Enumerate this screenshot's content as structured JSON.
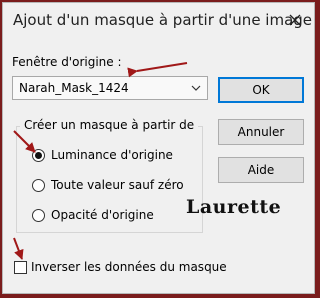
{
  "window": {
    "title": "Ajout d'un masque à partir d'une image",
    "close_icon": "close-icon"
  },
  "origin": {
    "label": "Fenêtre d'origine :",
    "selected_value": "Narah_Mask_1424",
    "dropdown_icon": "chevron-down-icon"
  },
  "buttons": {
    "ok": "OK",
    "cancel": "Annuler",
    "help": "Aide"
  },
  "group": {
    "legend": "Créer un masque à partir de",
    "options": [
      {
        "label": "Luminance d'origine",
        "selected": true
      },
      {
        "label": "Toute valeur sauf zéro",
        "selected": false
      },
      {
        "label": "Opacité d'origine",
        "selected": false
      }
    ]
  },
  "invert": {
    "label": "Inverser les données du masque",
    "checked": false
  },
  "watermark": {
    "text": "Laurette"
  },
  "colors": {
    "background": "#7a1c1c",
    "dialog": "#f0f0f0",
    "accent": "#0078d7",
    "arrow": "#a01818"
  }
}
